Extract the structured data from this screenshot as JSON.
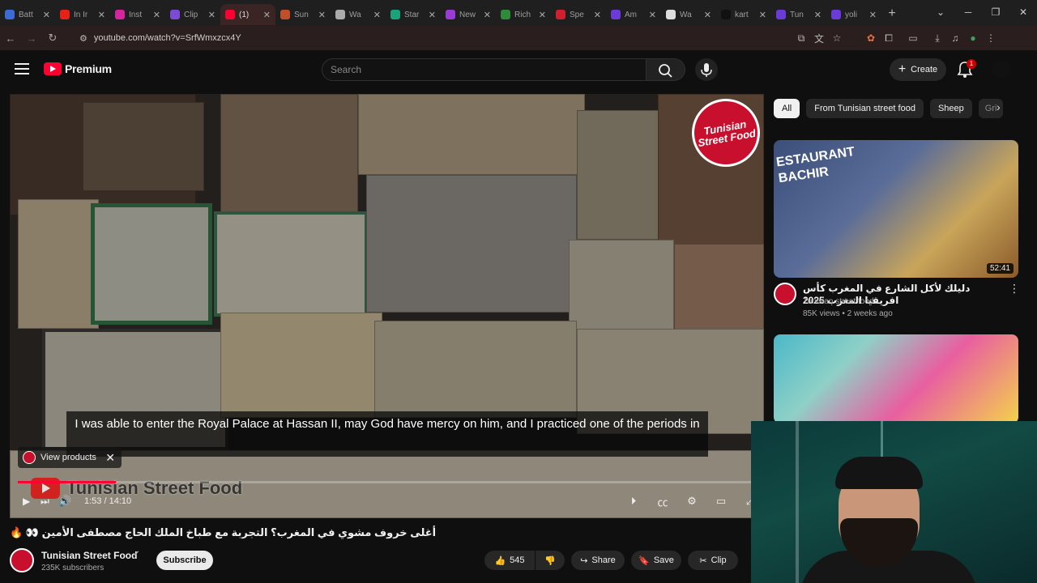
{
  "browser": {
    "tabs": [
      {
        "label": "Batt",
        "color": "#3b6bd6",
        "active": false
      },
      {
        "label": "In Ir",
        "color": "#e62117",
        "active": false
      },
      {
        "label": "Inst",
        "color": "#d6249f",
        "active": false
      },
      {
        "label": "Clip",
        "color": "#7b4bd6",
        "active": false
      },
      {
        "label": "(1)",
        "color": "#ff0033",
        "active": true
      },
      {
        "label": "Sun",
        "color": "#c0502a",
        "active": false
      },
      {
        "label": "Wa",
        "color": "#aaaaaa",
        "active": false
      },
      {
        "label": "Star",
        "color": "#1aa37a",
        "active": false
      },
      {
        "label": "New",
        "color": "#9b3bd6",
        "active": false
      },
      {
        "label": "Rich",
        "color": "#2f8a3a",
        "active": false
      },
      {
        "label": "Spe",
        "color": "#d01f2f",
        "active": false
      },
      {
        "label": "Am",
        "color": "#6a3bd6",
        "active": false
      },
      {
        "label": "Wa",
        "color": "#dddddd",
        "active": false
      },
      {
        "label": "kart",
        "color": "#111111",
        "active": false
      },
      {
        "label": "Tun",
        "color": "#6a3bd6",
        "active": false
      },
      {
        "label": "yoli",
        "color": "#6a3bd6",
        "active": false
      }
    ],
    "new_tab": "+",
    "url": "youtube.com/watch?v=SrfWmxzcx4Y"
  },
  "masthead": {
    "logo_text": "Premium",
    "search_placeholder": "Search",
    "create_label": "Create",
    "notification_count": "1"
  },
  "player": {
    "caption": "I was able to enter the Royal Palace at Hassan II, may God have mercy on him, and I practiced one of the periods in",
    "view_products": "View products",
    "watermark": "Tunisian Street Food",
    "logo_badge": "Tunisian Street Food",
    "time": "1:53 / 14:10",
    "progress": 0.133
  },
  "video": {
    "title": "أغلى خروف مشوي في المغرب؟ التجربة مع طباخ الملك الحاج مصطفى الأمين 👀 🔥",
    "channel_name": "Tunisian Street Food",
    "subscribers": "235K subscribers",
    "subscribe_label": "Subscribe",
    "like_count": "545",
    "share_label": "Share",
    "save_label": "Save",
    "clip_label": "Clip"
  },
  "sidebar": {
    "chips": [
      "All",
      "From Tunisian street food",
      "Sheep",
      "Gri"
    ],
    "recommendations": [
      {
        "thumbnail_text": "ESTAURANT BACHIR",
        "duration": "52:41",
        "title": "دليلك لأكل الشارع في المغرب كأس افريقيا المغرب 2025",
        "channel": "Tunisian street food",
        "meta": "85K views • 2 weeks ago"
      }
    ]
  },
  "colors": {
    "accent": "#ff0033",
    "background": "#0f0f0f",
    "chip_bg": "#272727"
  }
}
